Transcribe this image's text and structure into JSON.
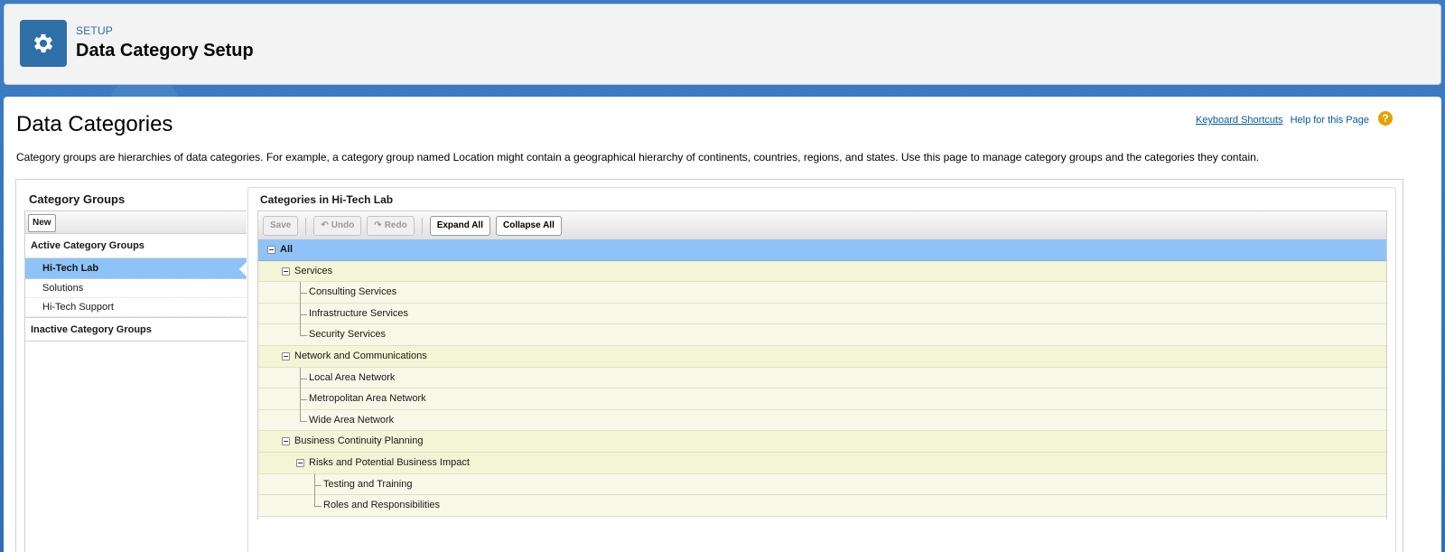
{
  "header": {
    "eyebrow": "SETUP",
    "title": "Data Category Setup",
    "icon": "gear-icon"
  },
  "page": {
    "title": "Data Categories",
    "keyboard_shortcuts": "Keyboard Shortcuts",
    "help": "Help for this Page",
    "description": "Category groups are hierarchies of data categories. For example, a category group named Location might contain a geographical hierarchy of continents, countries, regions, and states. Use this page to manage category groups and the categories they contain."
  },
  "left": {
    "title": "Category Groups",
    "new_label": "New",
    "active_section": "Active Category Groups",
    "items": [
      "Hi-Tech Lab",
      "Solutions",
      "Hi-Tech Support"
    ],
    "selected": "Hi-Tech Lab",
    "inactive_section": "Inactive Category Groups"
  },
  "right": {
    "title": "Categories in Hi-Tech Lab",
    "toolbar": {
      "save": "Save",
      "undo": "Undo",
      "redo": "Redo",
      "expand_all": "Expand All",
      "collapse_all": "Collapse All"
    },
    "tree": [
      {
        "label": "All",
        "level": 0
      },
      {
        "label": "Services",
        "level": 1
      },
      {
        "label": "Consulting Services",
        "level": 2
      },
      {
        "label": "Infrastructure Services",
        "level": 2
      },
      {
        "label": "Security Services",
        "level": 2
      },
      {
        "label": "Network and Communications",
        "level": 1
      },
      {
        "label": "Local Area Network",
        "level": 2
      },
      {
        "label": "Metropolitan Area Network",
        "level": 2
      },
      {
        "label": "Wide Area Network",
        "level": 2
      },
      {
        "label": "Business Continuity Planning",
        "level": 1
      },
      {
        "label": "Risks and Potential Business Impact",
        "level": 2
      },
      {
        "label": "Testing and Training",
        "level": 3
      },
      {
        "label": "Roles and Responsibilities",
        "level": 3
      }
    ]
  }
}
